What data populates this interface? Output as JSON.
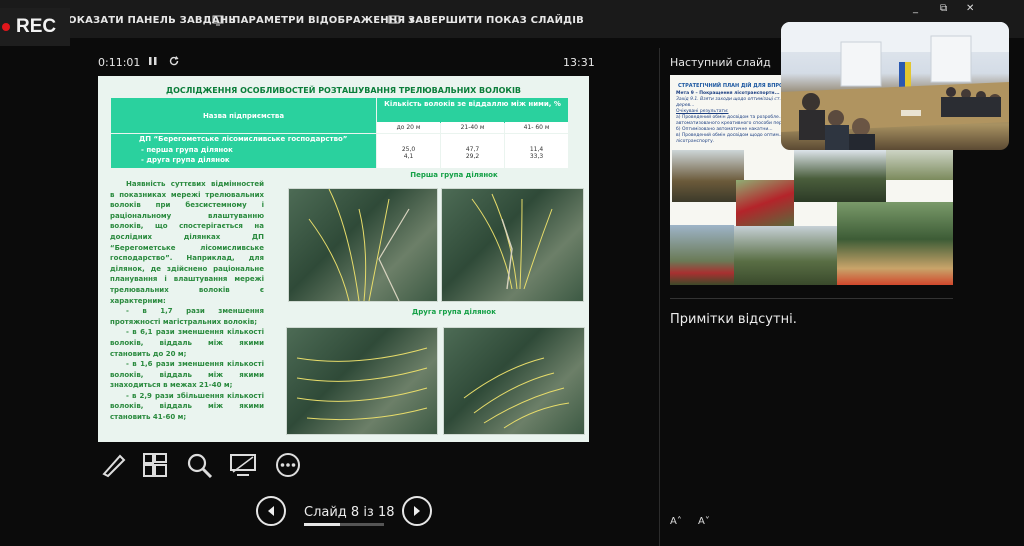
{
  "recording": {
    "label": "REC",
    "dot_color": "#e0161b"
  },
  "toolbar": {
    "show_taskbar": "ОКАЗАТИ ПАНЕЛЬ ЗАВДАНЬ",
    "display_settings": "ПАРАМЕТРИ ВІДОБРАЖЕННЯ ▾",
    "end_show": "ЗАВЕРШИТИ ПОКАЗ СЛАЙДІВ"
  },
  "window": {
    "minimize": "_",
    "restore": "⧉",
    "close": "✕"
  },
  "presenter": {
    "elapsed": "0:11:01",
    "clock": "13:31",
    "pause_icon": "pause-icon",
    "restart_icon": "restart-icon"
  },
  "slide": {
    "title": "ДОСЛІДЖЕННЯ ОСОБЛИВОСТЕЙ РОЗТАШУВАННЯ ТРЕЛЮВАЛЬНИХ ВОЛОКІВ",
    "table": {
      "col1_header": "Назва підприємства",
      "col2_header": "Кількість волоків зе віддаллю між ними, %",
      "sub_headers": [
        "до 20 м",
        "21-40 м",
        "41- 60 м"
      ],
      "enterprise": "ДП “Берегометське лісомисливське господарство”",
      "rows": [
        {
          "label": "- перша група ділянок",
          "values": [
            "25,0",
            "47,7",
            "11,4"
          ]
        },
        {
          "label": "- друга група ділянок",
          "values": [
            "4,1",
            "29,2",
            "33,3"
          ]
        }
      ]
    },
    "body_text": "Наявність суттєвих відмінностей в показниках мережі трелювальних волоків при безсистемному і раціональному влаштуванню волоків, що спостерігається на дослідних ділянках ДП “Берегометське лісомисливське господарство”. Наприклад, для ділянок, де здійснено раціональне планування і влаштування мережі трелювальних волоків є характерним:",
    "bullets": [
      "- в 1,7 рази зменшення протяжності магістральних волоків;",
      "- в 6,1 рази зменшення кількості волоків, віддаль між якими становить до 20 м;",
      "- в 1,6 рази зменшення кількості волоків, віддаль між якими знаходиться в межах 21-40 м;",
      "- в 2,9 рази збільшення кількості волоків, віддаль між якими становить 41-60 м;"
    ],
    "caption_group1": "Перша група ділянок",
    "caption_group2": "Друга група ділянок"
  },
  "tools": [
    "pen-icon",
    "slides-grid-icon",
    "zoom-icon",
    "screen-icon",
    "more-icon"
  ],
  "navigation": {
    "counter": "Слайд 8 із 18",
    "current": 8,
    "total": 18
  },
  "next_slide": {
    "label": "Наступний слайд",
    "heading": "СТРАТЕГІЧНИЙ ПЛАН ДІЙ ДЛЯ ВПРОВ...",
    "goal": "Мета 9 – Покращення лісотранспортн...",
    "task": "Захід 9.1. Взяти заходи щодо оптимізаці ст... дерев...",
    "expected_label": "Очікувані результати:",
    "lines": [
      "а) Проведений обмін досвідом та розробле...",
      "автоматизованого креативного способи перси...",
      "б) Оптимізовано автоматичне накатни...",
      "в) Проведений обмін досвідом щодо оптим...",
      "лісотранспорту."
    ]
  },
  "notes": {
    "text": "Примітки відсутні.",
    "increase": "A˄",
    "decrease": "A˅"
  }
}
